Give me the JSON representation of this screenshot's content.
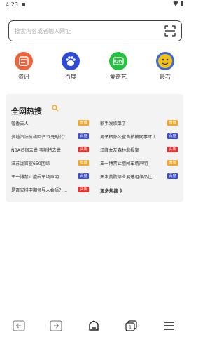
{
  "status": {
    "time": "4:23"
  },
  "search": {
    "placeholder": "搜索内容或者输入网址"
  },
  "quick_links": [
    {
      "label": "资讯",
      "icon": "news-icon",
      "color": "#f0623a"
    },
    {
      "label": "百度",
      "icon": "baidu-paw-icon",
      "color": "#2d4bd8"
    },
    {
      "label": "爱奇艺",
      "icon": "iqiyi-icon",
      "color": "#23c23f"
    },
    {
      "label": "最右",
      "icon": "zuiyou-icon",
      "color": "#f2c21c"
    }
  ],
  "hot": {
    "title": "全网热搜",
    "left": [
      {
        "text": "奢香夫人",
        "tag": "微博"
      },
      {
        "text": "多地汽油价格回归\"7元时代\"",
        "tag": "百度"
      },
      {
        "text": "NBA名宿去世 韦斯特去世",
        "tag": "头条"
      },
      {
        "text": "汪苏泷官宣650团综",
        "tag": "微博"
      },
      {
        "text": "王一博禁止擅闯车场声明",
        "tag": "百度"
      },
      {
        "text": "是否安排中期领导人会晤？...",
        "tag": "头条"
      }
    ],
    "right": [
      {
        "text": "歌手发歌单了",
        "tag": "微博"
      },
      {
        "text": "男子栖办公室自拍被同事盯上",
        "tag": "百度"
      },
      {
        "text": "汪峰女友森林北报案",
        "tag": "头条"
      },
      {
        "text": "王一博禁止擅闯车场声明",
        "tag": "微博"
      },
      {
        "text": "天津美院毕业展选组作品让...",
        "tag": "百度"
      }
    ],
    "more": "更多热搜 》",
    "tag_colors": {
      "微博": "#f5a623",
      "百度": "#3a4bd1",
      "头条": "#e8322f"
    }
  }
}
